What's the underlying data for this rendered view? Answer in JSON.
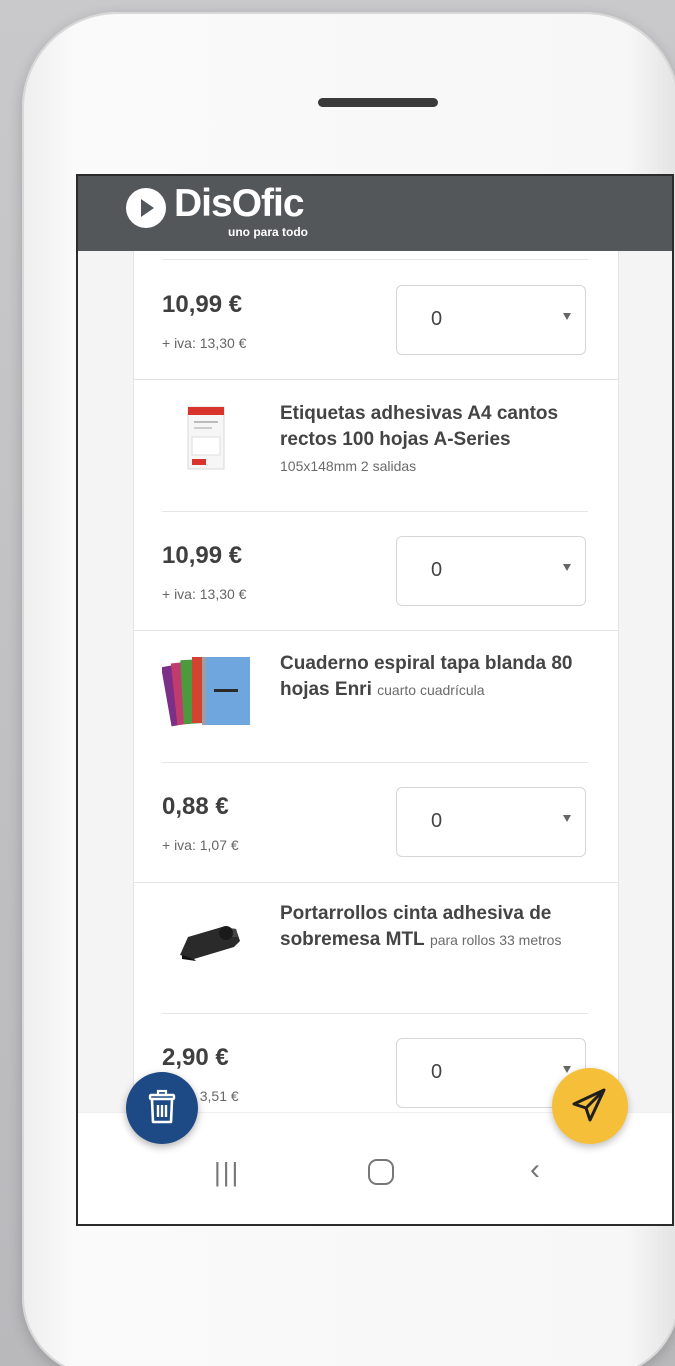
{
  "app": {
    "brand": "DisOfic",
    "tagline": "uno para todo"
  },
  "colors": {
    "header": "#53575a",
    "delete_fab": "#1d4985",
    "send_fab": "#f6bf3a"
  },
  "top_item": {
    "price": "10,99 €",
    "iva": "+ iva: 13,30 €",
    "quantity": "0"
  },
  "products": [
    {
      "name_bold": "Etiquetas adhesivas A4 cantos rectos 100 hojas A-Series",
      "description": "105x148mm 2 salidas",
      "price": "10,99 €",
      "iva": "+ iva: 13,30 €",
      "quantity": "0",
      "icon": "labels-sheet-image"
    },
    {
      "name_bold": "Cuaderno espiral tapa blanda 80 hojas Enri",
      "description": "cuarto cuadrícula",
      "price": "0,88 €",
      "iva": "+ iva: 1,07 €",
      "quantity": "0",
      "icon": "spiral-notebooks-image"
    },
    {
      "name_bold": "Portarrollos cinta adhesiva de sobremesa MTL",
      "description": "para rollos 33 metros",
      "price": "2,90 €",
      "iva": "+ iva: 3,51 €",
      "quantity": "0",
      "icon": "tape-dispenser-image"
    }
  ],
  "fabs": {
    "delete_icon": "trash-icon",
    "send_icon": "paper-plane-icon"
  },
  "navbar": {
    "recents_icon": "recents-icon",
    "home_icon": "home-icon",
    "back_icon": "back-icon"
  }
}
